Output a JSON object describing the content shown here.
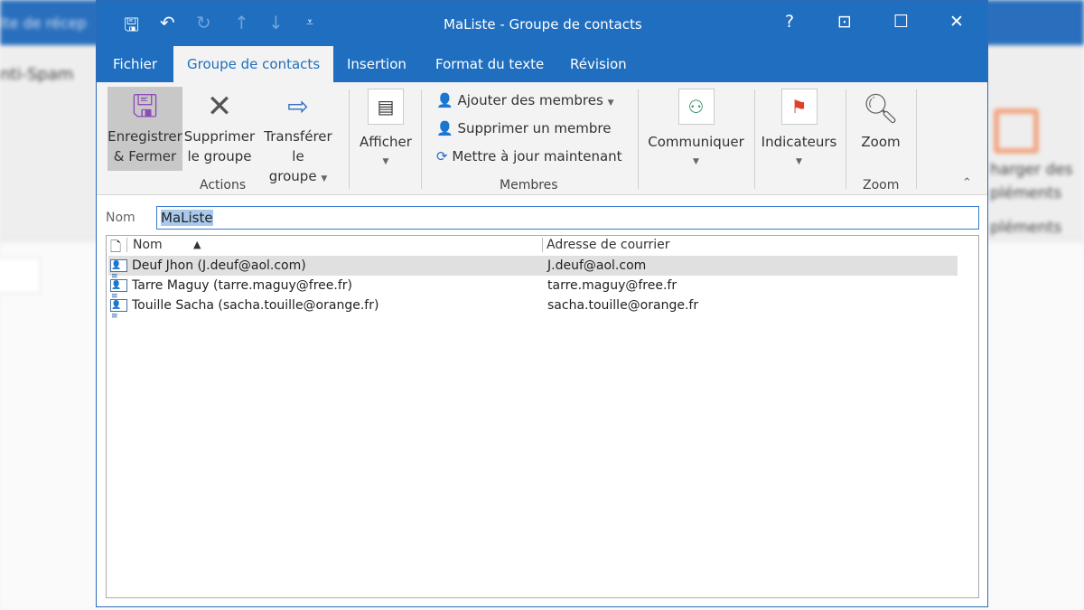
{
  "background": {
    "app_bar_text": "lte de récep",
    "ribbon_text": "nti-Spam",
    "right_text": [
      "harger des",
      "pléments",
      "pléments"
    ]
  },
  "window": {
    "title": "MaListe  -  Groupe de contacts",
    "quick_access": [
      "save-icon",
      "undo-icon",
      "redo-icon",
      "up-icon",
      "down-icon",
      "customize-icon"
    ],
    "controls": {
      "help": "?"
    }
  },
  "tabs": [
    {
      "label": "Fichier"
    },
    {
      "label": "Groupe de contacts",
      "active": true
    },
    {
      "label": "Insertion"
    },
    {
      "label": "Format du texte"
    },
    {
      "label": "Révision"
    }
  ],
  "ribbon": {
    "actions": {
      "save_close": [
        "Enregistrer",
        "& Fermer"
      ],
      "delete_group": [
        "Supprimer",
        "le groupe"
      ],
      "forward_group": [
        "Transférer le",
        "groupe"
      ],
      "label": "Actions"
    },
    "show": {
      "label": "Afficher"
    },
    "members": {
      "add": "Ajouter des membres",
      "remove": "Supprimer un membre",
      "update": "Mettre à jour maintenant",
      "label": "Membres"
    },
    "communicate": {
      "label": "Communiquer"
    },
    "tags": {
      "label": "Indicateurs"
    },
    "zoom": {
      "button": "Zoom",
      "label": "Zoom"
    }
  },
  "name_field": {
    "label": "Nom",
    "value": "MaListe"
  },
  "list": {
    "columns": [
      "Nom",
      "Adresse de courrier"
    ],
    "rows": [
      {
        "name": "Deuf Jhon (J.deuf@aol.com)",
        "email": "J.deuf@aol.com",
        "selected": true
      },
      {
        "name": "Tarre Maguy (tarre.maguy@free.fr)",
        "email": "tarre.maguy@free.fr"
      },
      {
        "name": "Touille Sacha (sacha.touille@orange.fr)",
        "email": "sacha.touille@orange.fr"
      }
    ]
  }
}
